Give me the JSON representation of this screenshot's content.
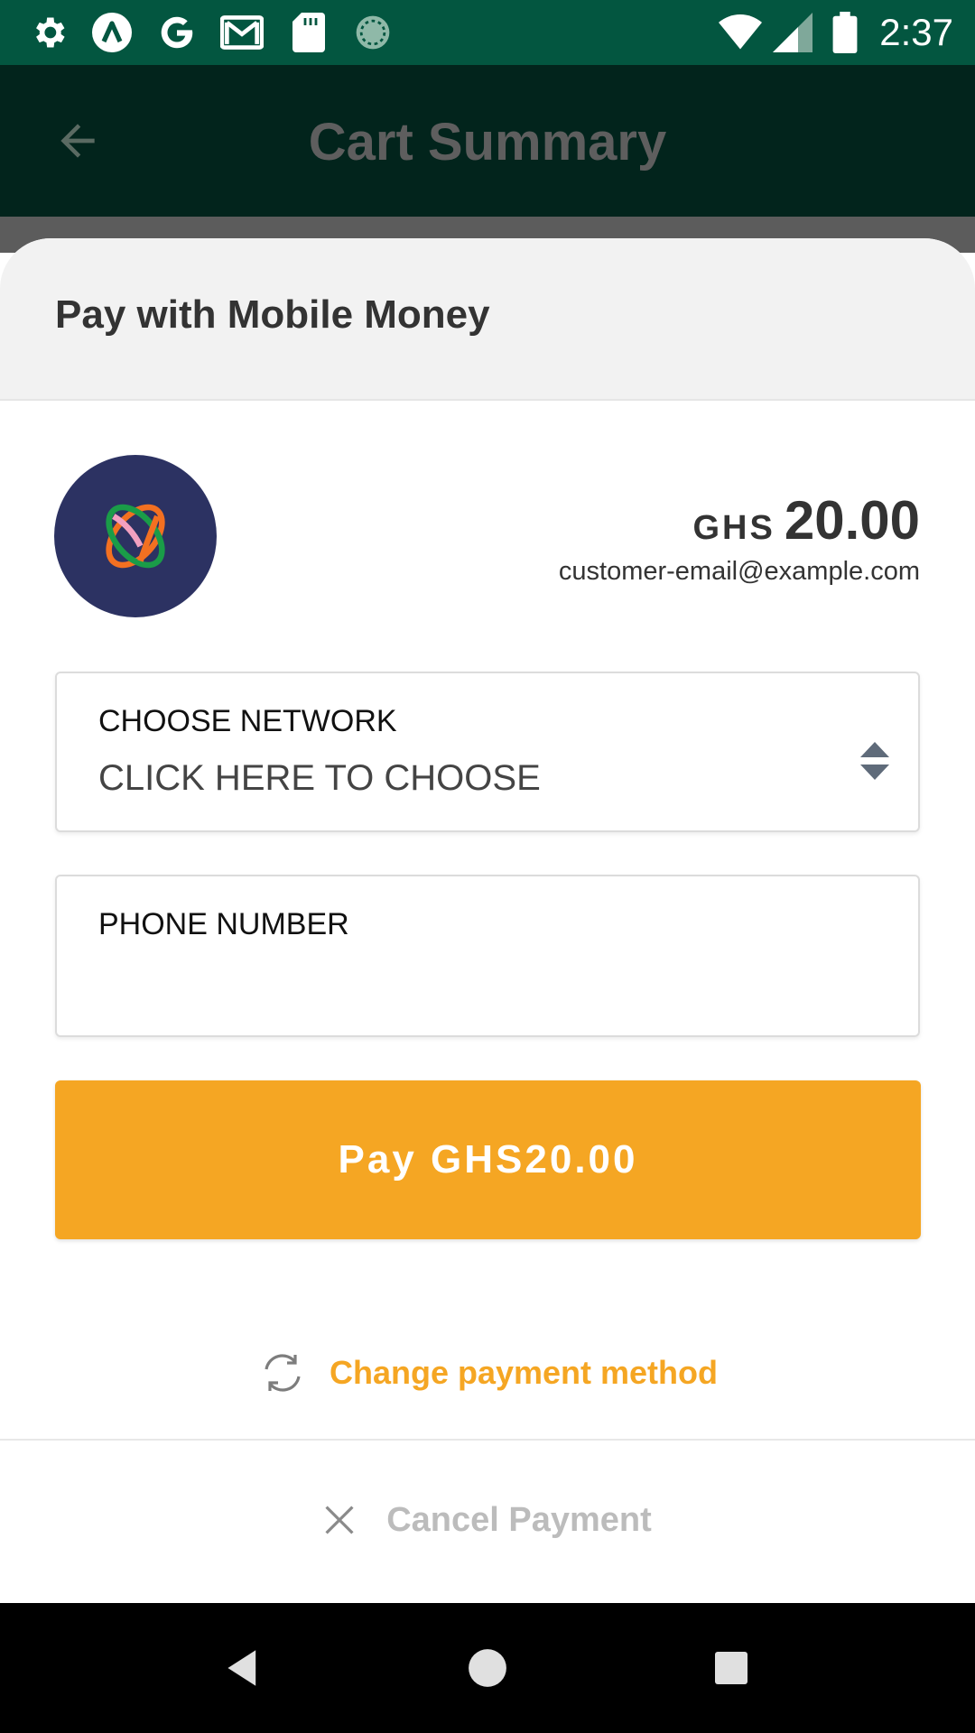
{
  "status_bar": {
    "time": "2:37",
    "icons": [
      "settings-icon",
      "a-circle-icon",
      "google-icon",
      "gmail-icon",
      "sd-card-icon",
      "sync-circle-icon",
      "wifi-icon",
      "cell-signal-icon",
      "battery-icon"
    ]
  },
  "app_bar": {
    "title": "Cart Summary",
    "back_icon": "arrow-back-icon"
  },
  "sheet": {
    "title": "Pay with Mobile Money",
    "amount": {
      "currency": "GHS",
      "value": "20.00"
    },
    "customer_email": "customer-email@example.com",
    "network_field": {
      "label": "CHOOSE NETWORK",
      "value": "CLICK HERE TO CHOOSE"
    },
    "phone_field": {
      "label": "PHONE NUMBER",
      "value": ""
    },
    "pay_button": "Pay GHS20.00",
    "change_method": "Change payment method",
    "cancel": "Cancel Payment"
  },
  "colors": {
    "status_bar": "#035640",
    "accent": "#f5a623",
    "logo_bg": "#2c3262"
  },
  "nav_bar": {
    "buttons": [
      "back-triangle-icon",
      "home-circle-icon",
      "recents-square-icon"
    ]
  }
}
